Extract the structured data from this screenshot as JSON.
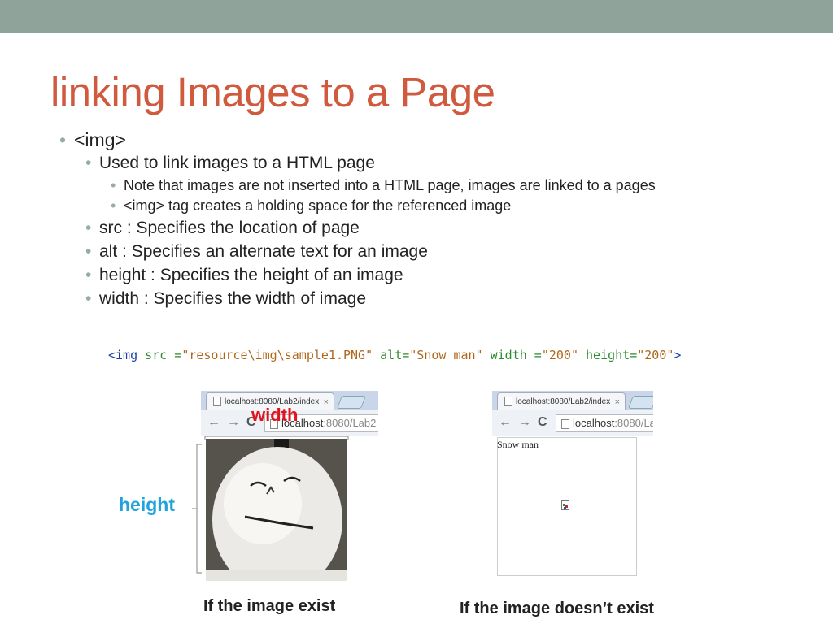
{
  "slide": {
    "title": "linking Images to a Page",
    "bullets": {
      "b1": "<img>",
      "b1_1": "Used to link images to a HTML page",
      "b1_1_1": "Note that images are not inserted into a HTML page, images are linked to a pages",
      "b1_1_2": "<img> tag creates a holding space for the referenced image",
      "b1_2": "src : Specifies the location of page",
      "b1_3": "alt : Specifies an alternate text for an image",
      "b1_4": "height : Specifies the height of an image",
      "b1_5": "width : Specifies the width of image"
    },
    "code": {
      "open": "<img",
      "src_attr": "src",
      "src_eq": " =",
      "src_val": "\"resource\\img\\sample1.PNG\"",
      "alt_attr": "alt",
      "alt_eq": "=",
      "alt_val": "\"Snow man\"",
      "width_attr": "width",
      "width_eq": " =",
      "width_val": "\"200\"",
      "height_attr": "height",
      "height_eq": "=",
      "height_val": "\"200\"",
      "close": ">"
    },
    "left_browser": {
      "tab_label": "localhost:8080/Lab2/index",
      "tab_close": "×",
      "url_host": "localhost",
      "url_rest": ":8080/Lab2"
    },
    "right_browser": {
      "tab_label": "localhost:8080/Lab2/index",
      "tab_close": "×",
      "url_host": "localhost",
      "url_rest": ":8080/La"
    },
    "broken_alt_text": "Snow man",
    "labels": {
      "width": "width",
      "height": "height"
    },
    "captions": {
      "exists": "If the image exist",
      "not_exists": "If the image doesn’t exist"
    },
    "colors": {
      "title": "#d05a3e",
      "topbar": "#8fa39a",
      "width_label": "#e0141e",
      "height_label": "#1fa3dc"
    }
  }
}
